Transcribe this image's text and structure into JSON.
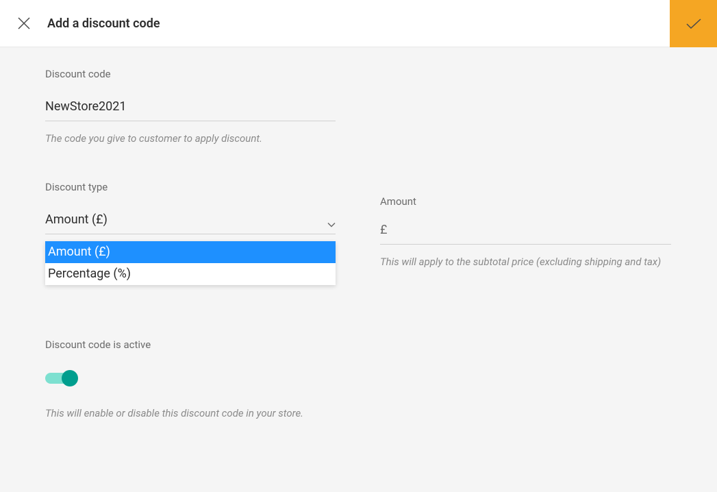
{
  "header": {
    "title": "Add a discount code"
  },
  "discount_code": {
    "label": "Discount code",
    "value": "NewStore2021",
    "hint": "The code you give to customer to apply discount."
  },
  "discount_type": {
    "label": "Discount type",
    "selected": "Amount (£)",
    "options": [
      "Amount (£)",
      "Percentage (%)"
    ]
  },
  "amount": {
    "label": "Amount",
    "currency": "£",
    "value": "",
    "hint": "This will apply to the subtotal price (excluding shipping and tax)"
  },
  "active": {
    "label": "Discount code is active",
    "hint": "This will enable or disable this discount code in your store."
  }
}
